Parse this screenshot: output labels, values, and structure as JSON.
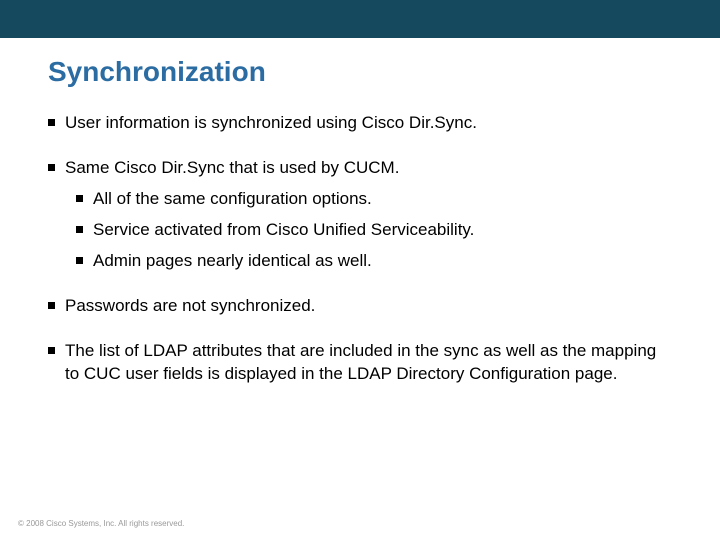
{
  "title": "Synchronization",
  "bullets": {
    "b1": "User information is synchronized using Cisco Dir.Sync.",
    "b2": "Same Cisco Dir.Sync that is used by CUCM.",
    "b2_1": "All of the same configuration options.",
    "b2_2": "Service activated from Cisco Unified Serviceability.",
    "b2_3": "Admin pages nearly identical as well.",
    "b3": "Passwords are not synchronized.",
    "b4": "The list of LDAP attributes that are included in the sync as well as the mapping to CUC user fields is displayed in the LDAP Directory Configuration page."
  },
  "footer": "© 2008 Cisco Systems, Inc. All rights reserved."
}
